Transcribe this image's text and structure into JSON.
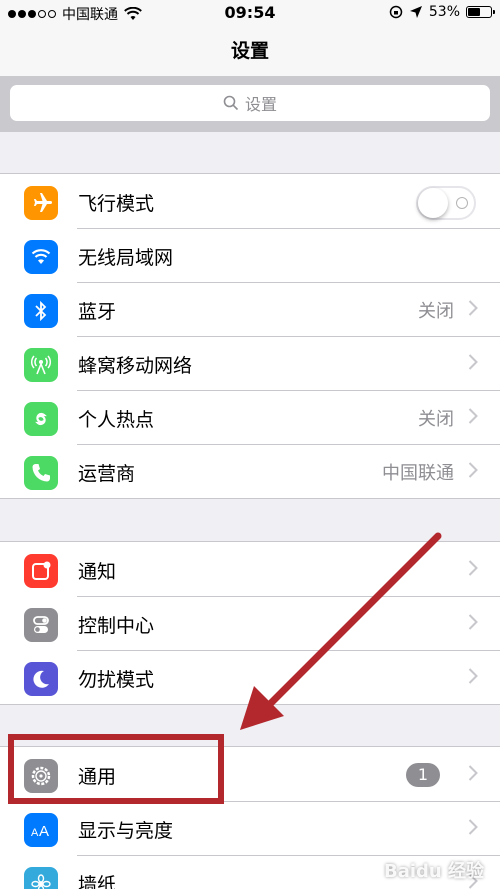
{
  "status_bar": {
    "carrier": "中国联通",
    "time": "09:54",
    "battery": "53%"
  },
  "nav": {
    "title": "设置"
  },
  "search": {
    "placeholder": "设置"
  },
  "groups": [
    {
      "rows": [
        {
          "label": "飞行模式",
          "icon": "airplane-icon",
          "color": "#ff9500",
          "toggle": false
        },
        {
          "label": "无线局域网",
          "icon": "wifi-icon",
          "color": "#007aff",
          "detail": ""
        },
        {
          "label": "蓝牙",
          "icon": "bluetooth-icon",
          "color": "#007aff",
          "detail": "关闭"
        },
        {
          "label": "蜂窝移动网络",
          "icon": "cellular-icon",
          "color": "#4cd964",
          "detail": ""
        },
        {
          "label": "个人热点",
          "icon": "hotspot-icon",
          "color": "#4cd964",
          "detail": "关闭"
        },
        {
          "label": "运营商",
          "icon": "phone-icon",
          "color": "#4cd964",
          "detail": "中国联通"
        }
      ]
    },
    {
      "rows": [
        {
          "label": "通知",
          "icon": "notification-icon",
          "color": "#ff3b30"
        },
        {
          "label": "控制中心",
          "icon": "control-center-icon",
          "color": "#8e8e93"
        },
        {
          "label": "勿扰模式",
          "icon": "moon-icon",
          "color": "#5856d6"
        }
      ]
    },
    {
      "rows": [
        {
          "label": "通用",
          "icon": "gear-icon",
          "color": "#8e8e93",
          "badge": "1"
        },
        {
          "label": "显示与亮度",
          "icon": "text-size-icon",
          "color": "#007aff"
        },
        {
          "label": "墙纸",
          "icon": "wallpaper-icon",
          "color": "#34aadc"
        }
      ]
    }
  ],
  "watermark": "Baidu 经验"
}
